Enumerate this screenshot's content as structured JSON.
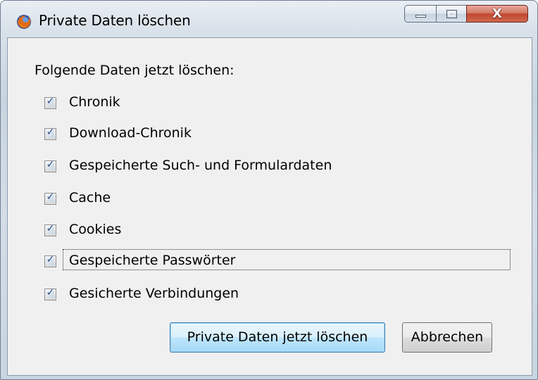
{
  "window": {
    "title": "Private Daten löschen",
    "icon": "firefox-icon",
    "close_glyph": "X"
  },
  "dialog": {
    "prompt": "Folgende Daten jetzt löschen:",
    "options": [
      {
        "label": "Chronik",
        "checked": true
      },
      {
        "label": "Download-Chronik",
        "checked": true
      },
      {
        "label": "Gespeicherte Such- und Formulardaten",
        "checked": true
      },
      {
        "label": "Cache",
        "checked": true
      },
      {
        "label": "Cookies",
        "checked": true
      },
      {
        "label": "Gespeicherte Passwörter",
        "checked": true,
        "focused": true
      },
      {
        "label": "Gesicherte Verbindungen",
        "checked": true
      }
    ],
    "check_glyph": "✓",
    "buttons": {
      "clear_now": "Private Daten jetzt löschen",
      "cancel": "Abbrechen"
    }
  },
  "colors": {
    "accent": "#3c7fb1",
    "close_button": "#c24530",
    "checkmark": "#2a4a8a"
  }
}
